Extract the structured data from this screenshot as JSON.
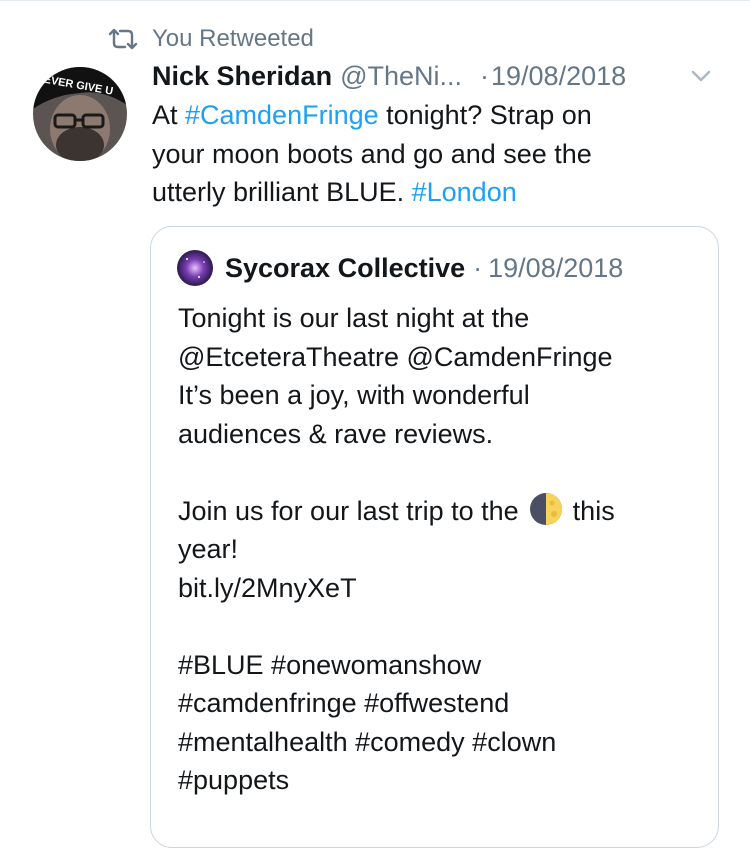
{
  "retweet": {
    "label": "You Retweeted"
  },
  "tweet": {
    "author_name": "Nick Sheridan",
    "author_handle": "@TheNi...",
    "separator": "·",
    "date": "19/08/2018",
    "text": [
      {
        "segments": [
          {
            "t": "At ",
            "link": false
          },
          {
            "t": "#CamdenFringe",
            "link": true
          },
          {
            "t": " tonight? Strap on",
            "link": false
          }
        ]
      },
      {
        "segments": [
          {
            "t": "your moon boots and go and see the",
            "link": false
          }
        ]
      },
      {
        "segments": [
          {
            "t": "utterly brilliant BLUE. ",
            "link": false
          },
          {
            "t": "#London",
            "link": true
          }
        ]
      }
    ],
    "avatar_text": "EVER GIVE U"
  },
  "quote": {
    "author_name": "Sycorax Collective",
    "separator": "·",
    "date": "19/08/2018",
    "lines": [
      "Tonight is our last night at the",
      "@EtceteraTheatre @CamdenFringe",
      "It’s been a joy, with wonderful",
      "audiences & rave reviews.",
      "",
      "Join us for our last trip to the",
      "year!",
      "bit.ly/2MnyXeT",
      "",
      "#BLUE #onewomanshow",
      "#camdenfringe #offwestend",
      "#mentalhealth #comedy #clown",
      "#puppets"
    ],
    "moon_suffix": "this"
  },
  "colors": {
    "link": "#1da1f2",
    "muted": "#657786",
    "text": "#14171a",
    "border": "#ccd6dd"
  },
  "icons": {
    "retweet": "retweet-icon",
    "chevron": "chevron-down-icon",
    "moon": "first-quarter-moon-icon"
  }
}
